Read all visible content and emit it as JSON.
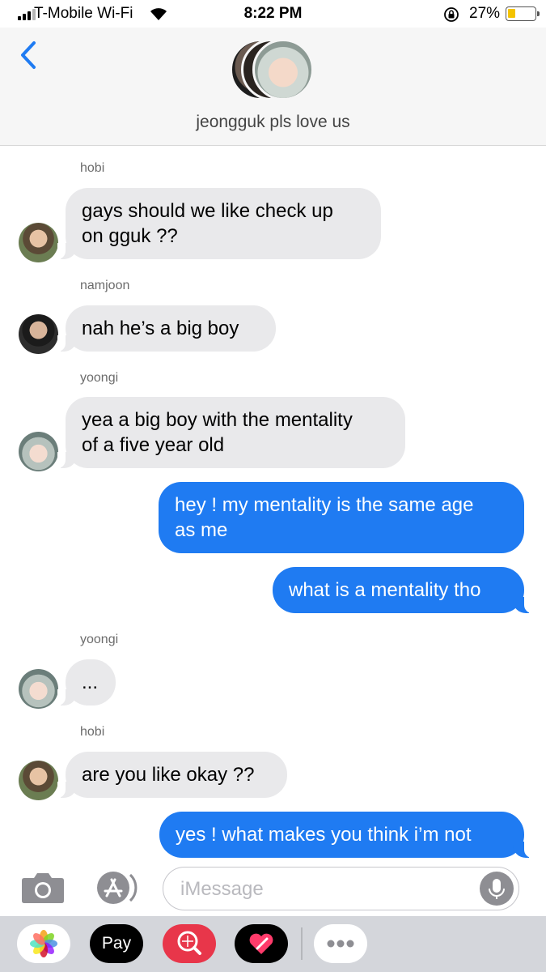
{
  "status_bar": {
    "carrier": "T-Mobile Wi-Fi",
    "time": "8:22 PM",
    "battery_percent": "27%",
    "battery_level": 0.27
  },
  "header": {
    "back_icon": "chevron-left-icon",
    "group_name": "jeongguk pls love us"
  },
  "messages": [
    {
      "sender": "hobi",
      "direction": "incoming",
      "text": "gays should we like check up",
      "text2": "on gguk ??"
    },
    {
      "sender": "namjoon",
      "direction": "incoming",
      "text": "nah he’s a big boy"
    },
    {
      "sender": "yoongi",
      "direction": "incoming",
      "text": "yea a big boy with the mentality",
      "text2": "of a five year old"
    },
    {
      "direction": "outgoing",
      "text": "hey ! my mentality is the same age",
      "text2": "as me"
    },
    {
      "direction": "outgoing",
      "text": "what is a mentality tho"
    },
    {
      "sender": "yoongi",
      "direction": "incoming",
      "text": "..."
    },
    {
      "sender": "hobi",
      "direction": "incoming",
      "text": "are you like okay ??"
    },
    {
      "direction": "outgoing",
      "text": "yes ! what makes you think i’m not"
    }
  ],
  "input_bar": {
    "placeholder": "iMessage",
    "camera_icon": "camera-icon",
    "appstore_icon": "app-store-icon",
    "mic_icon": "microphone-icon"
  },
  "app_drawer": {
    "apple_pay_label": "Pay",
    "apps": [
      "photos-app-icon",
      "apple-pay-icon",
      "image-search-icon",
      "digital-touch-icon",
      "more-apps-icon"
    ]
  },
  "colors": {
    "outgoing_bubble": "#1f7bf2",
    "incoming_bubble": "#e9e9eb",
    "header_bg": "#f6f6f6",
    "drawer_bg": "#d4d6db"
  }
}
